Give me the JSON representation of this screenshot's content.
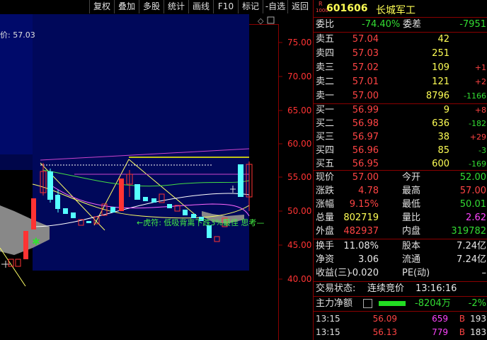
{
  "toolbar": {
    "items": [
      "复权",
      "叠加",
      "多股",
      "统计",
      "画线",
      "F10",
      "标记",
      "-自选",
      "返回"
    ]
  },
  "chart": {
    "price_label": "价: 57.03",
    "axis": [
      "75.00",
      "70.00",
      "65.00",
      "60.00",
      "55.00",
      "50.00",
      "45.00",
      "40.00"
    ],
    "annotation": "←虎符: 低吸背离下跌3%最佳 思考—",
    "colors": {
      "up": "#ff3333",
      "down": "#55ffff",
      "bg_band": "#000a6a"
    }
  },
  "stock": {
    "badge_top": "R",
    "badge_bottom": "1000",
    "code": "601606",
    "name": "长城军工"
  },
  "weibi": {
    "label1": "委比",
    "value1": "-74.40%",
    "label2": "委差",
    "value2": "-7951"
  },
  "sell": [
    {
      "label": "卖五",
      "price": "57.04",
      "vol": "42",
      "chg": ""
    },
    {
      "label": "卖四",
      "price": "57.03",
      "vol": "251",
      "chg": ""
    },
    {
      "label": "卖三",
      "price": "57.02",
      "vol": "109",
      "chg": "+1"
    },
    {
      "label": "卖二",
      "price": "57.01",
      "vol": "121",
      "chg": "+2"
    },
    {
      "label": "卖一",
      "price": "57.00",
      "vol": "8796",
      "chg": "-1166"
    }
  ],
  "buy": [
    {
      "label": "买一",
      "price": "56.99",
      "vol": "9",
      "chg": "+8"
    },
    {
      "label": "买二",
      "price": "56.98",
      "vol": "636",
      "chg": "-182"
    },
    {
      "label": "买三",
      "price": "56.97",
      "vol": "38",
      "chg": "+29"
    },
    {
      "label": "买四",
      "price": "56.96",
      "vol": "85",
      "chg": "-3"
    },
    {
      "label": "买五",
      "price": "56.95",
      "vol": "600",
      "chg": "-169"
    }
  ],
  "stats": [
    {
      "l1": "现价",
      "v1": "57.00",
      "l2": "今开",
      "v2": "52.00"
    },
    {
      "l1": "涨跌",
      "v1": "4.78",
      "l2": "最高",
      "v2": "57.00"
    },
    {
      "l1": "涨幅",
      "v1": "9.15%",
      "l2": "最低",
      "v2": "50.01"
    },
    {
      "l1": "总量",
      "v1": "802719",
      "l2": "量比",
      "v2": "2.62"
    },
    {
      "l1": "外盘",
      "v1": "482937",
      "l2": "内盘",
      "v2": "319782"
    }
  ],
  "stats2": [
    {
      "l1": "换手",
      "v1": "11.08%",
      "l2": "股本",
      "v2": "7.24亿"
    },
    {
      "l1": "净资",
      "v1": "3.06",
      "l2": "流通",
      "v2": "7.24亿"
    },
    {
      "l1": "收益(三)",
      "v1": "-0.020",
      "l2": "PE(动)",
      "v2": "–"
    }
  ],
  "trade_state": {
    "label": "交易状态:",
    "value": "连续竞价",
    "time": "13:16:16"
  },
  "main_flow": {
    "label": "主力净额",
    "value": "-8204万",
    "pct": "-2%"
  },
  "ticks": [
    {
      "time": "13:15",
      "price": "56.09",
      "vol": "659",
      "dir": "B",
      "num": "193"
    },
    {
      "time": "13:15",
      "price": "56.13",
      "vol": "779",
      "dir": "B",
      "num": "183"
    }
  ]
}
